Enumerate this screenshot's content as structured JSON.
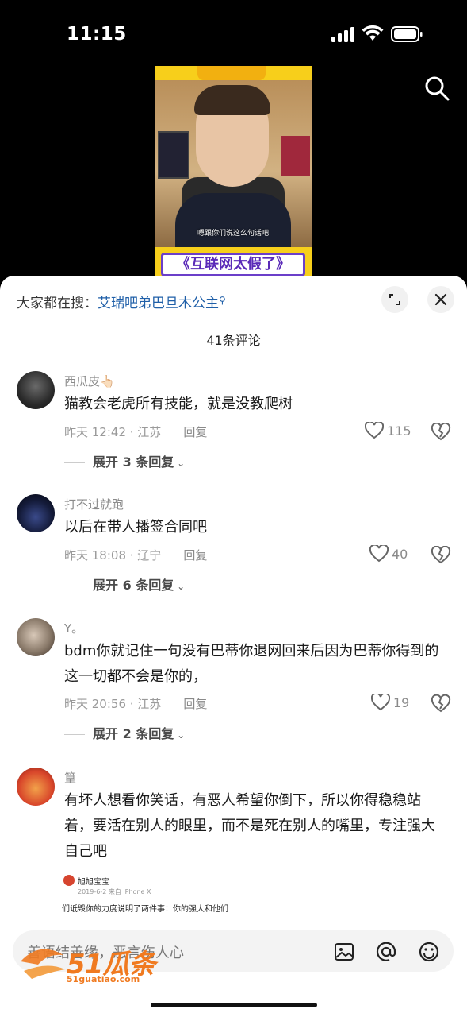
{
  "status": {
    "time": "11:15"
  },
  "video": {
    "subtitle": "嗯跟你们说这么句话吧",
    "banner": "《互联网太假了》"
  },
  "sheet": {
    "hot_label": "大家都在搜：",
    "hot_keyword": "艾瑞吧弟巴旦木公主",
    "comment_count": "41条评论"
  },
  "comments": [
    {
      "user": "西瓜皮👆🏻",
      "text": "猫教会老虎所有技能，就是没教爬树",
      "time": "昨天 12:42 · 江苏",
      "reply": "回复",
      "likes": "115",
      "expand": "展开 3 条回复"
    },
    {
      "user": "打不过就跑",
      "text": "以后在带人播签合同吧",
      "time": "昨天 18:08 · 辽宁",
      "reply": "回复",
      "likes": "40",
      "expand": "展开 6 条回复"
    },
    {
      "user": "Y。",
      "text": "bdm你就记住一句没有巴蒂你退网回来后因为巴蒂你得到的这一切都不会是你的，",
      "time": "昨天 20:56 · 江苏",
      "reply": "回复",
      "likes": "19",
      "expand": "展开 2 条回复"
    },
    {
      "user": "篁",
      "text": "有坏人想看你笑话，有恶人希望你倒下，所以你得稳稳站着，要活在别人的眼里，而不是死在别人的嘴里，专注强大自己吧",
      "quote_name": "旭旭宝宝",
      "quote_sub": "2019-6-2 来自 iPhone X",
      "quote_text": "们诋毁你的力度说明了两件事：你的强大和他们"
    }
  ],
  "input": {
    "placeholder": "善语结善缘，恶言伤人心"
  },
  "watermark": {
    "brand": "51瓜条",
    "url": "51guatiao.com"
  }
}
